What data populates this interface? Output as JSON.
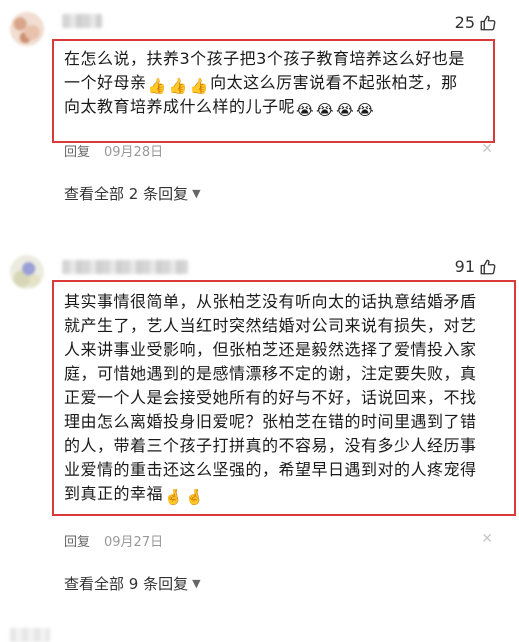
{
  "comments": [
    {
      "likes": "25",
      "text_lines": [
        "在怎么说，扶养3个孩子把3个孩子教育培养这么好也是",
        "一个好母亲",
        "向太这么厉害说看不起张柏芝，那",
        "向太教育培养成什么样的儿子呢"
      ],
      "reply_label": "回复",
      "date": "09月28日",
      "view_all": "查看全部 2 条回复"
    },
    {
      "likes": "91",
      "text_lines": [
        "其实事情很简单，从张柏芝没有听向太的话执意结婚矛盾",
        "就产生了，艺人当红时突然结婚对公司来说有损失，对艺",
        "人来讲事业受影响，但张柏芝还是毅然选择了爱情投入家",
        "庭，可惜她遇到的是感情漂移不定的谢，注定要失败，真",
        "正爱一个人是会接受她所有的好与不好，话说回来，不找",
        "理由怎么离婚投身旧爱呢？张柏芝在错的时间里遇到了错",
        "的人，带着三个孩子打拼真的不容易，没有多少人经历事",
        "业爱情的重击还这么坚强的，希望早日遇到对的人疼宠得",
        "到真正的幸福"
      ],
      "reply_label": "回复",
      "date": "09月27日",
      "view_all": "查看全部 9 条回复"
    }
  ],
  "icons": {
    "like": "thumbs-up-icon",
    "close": "close-icon",
    "chevron": "chevron-down-icon",
    "thumb_emoji": "👍",
    "cry_emoji": "😭",
    "cross_fingers_emoji": "🤞"
  },
  "colors": {
    "highlight_border": "#d93a3a",
    "text": "#1a1a1a",
    "muted": "#999999"
  }
}
